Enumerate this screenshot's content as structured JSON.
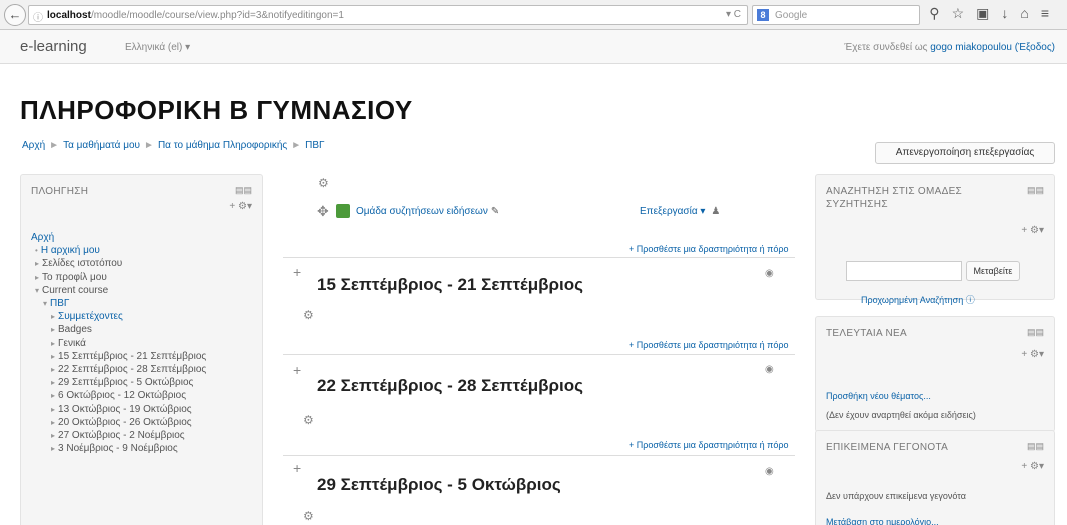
{
  "browser": {
    "url_host": "localhost",
    "url_rest": "/moodle/moodle/course/view.php?id=3&notifyeditingon=1",
    "search_placeholder": "Google",
    "g_label": "8"
  },
  "moodle_nav": {
    "brand": "e-learning",
    "language": "Ελληνικά (el) ▾",
    "login_prefix": "Έχετε συνδεθεί ως",
    "user_name": "gogo miakopoulou",
    "logout": "(Έξοδος)"
  },
  "page_title": "ΠΛΗΡΟΦΟΡΙΚΗ Β ΓΥΜΝΑΣΙΟΥ",
  "breadcrumb": [
    "Αρχή",
    "Τα μαθήματά μου",
    "Πα το μάθημα Πληροφορικής",
    "ΠΒΓ"
  ],
  "edit_button": "Απενεργοποίηση επεξεργασίας",
  "navigation_block": {
    "title": "ΠΛΟΗΓΗΣΗ",
    "items": [
      {
        "label": "Αρχή",
        "type": "link",
        "indent": 0,
        "arrow": ""
      },
      {
        "label": "Η αρχική μου",
        "type": "link",
        "indent": 1,
        "arrow": "•"
      },
      {
        "label": "Σελίδες ιστοτόπου",
        "type": "plain",
        "indent": 1,
        "arrow": "▸"
      },
      {
        "label": "Το προφίλ μου",
        "type": "plain",
        "indent": 1,
        "arrow": "▸"
      },
      {
        "label": "Current course",
        "type": "plain",
        "indent": 1,
        "arrow": "▾"
      },
      {
        "label": "ΠΒΓ",
        "type": "link",
        "indent": 2,
        "arrow": "▾"
      },
      {
        "label": "Συμμετέχοντες",
        "type": "link",
        "indent": 3,
        "arrow": "▸"
      },
      {
        "label": "Badges",
        "type": "plain",
        "indent": 3,
        "arrow": "▸"
      },
      {
        "label": "Γενικά",
        "type": "plain",
        "indent": 3,
        "arrow": "▸"
      },
      {
        "label": "15 Σεπτέμβριος - 21 Σεπτέμβριος",
        "type": "plain",
        "indent": 3,
        "arrow": "▸"
      },
      {
        "label": "22 Σεπτέμβριος - 28 Σεπτέμβριος",
        "type": "plain",
        "indent": 3,
        "arrow": "▸"
      },
      {
        "label": "29 Σεπτέμβριος - 5 Οκτώβριος",
        "type": "plain",
        "indent": 3,
        "arrow": "▸"
      },
      {
        "label": "6 Οκτώβριος - 12 Οκτώβριος",
        "type": "plain",
        "indent": 3,
        "arrow": "▸"
      },
      {
        "label": "13 Οκτώβριος - 19 Οκτώβριος",
        "type": "plain",
        "indent": 3,
        "arrow": "▸"
      },
      {
        "label": "20 Οκτώβριος - 26 Οκτώβριος",
        "type": "plain",
        "indent": 3,
        "arrow": "▸"
      },
      {
        "label": "27 Οκτώβριος - 2 Νοέμβριος",
        "type": "plain",
        "indent": 3,
        "arrow": "▸"
      },
      {
        "label": "3 Νοέμβριος - 9 Νοέμβριος",
        "type": "plain",
        "indent": 3,
        "arrow": "▸"
      }
    ]
  },
  "center": {
    "forum_link": "Ομάδα συζητήσεων ειδήσεων",
    "edit_menu": "Επεξεργασία ▾",
    "add_activity": "+ Προσθέστε μια δραστηριότητα ή πόρο",
    "sections": [
      "15 Σεπτέμβριος - 21 Σεπτέμβριος",
      "22 Σεπτέμβριος - 28 Σεπτέμβριος",
      "29 Σεπτέμβριος - 5 Οκτώβριος"
    ]
  },
  "search_block": {
    "title_line1": "ΑΝΑΖΗΤΗΣΗ ΣΤΙΣ ΟΜΑΔΕΣ",
    "title_line2": "ΣΥΖΗΤΗΣΗΣ",
    "button": "Μεταβείτε",
    "advanced": "Προχωρημένη Αναζήτηση ⓘ"
  },
  "news_block": {
    "title": "ΤΕΛΕΥΤΑΙΑ ΝΕΑ",
    "add_topic": "Προσθήκη νέου θέματος...",
    "empty": "(Δεν έχουν αναρτηθεί ακόμα ειδήσεις)"
  },
  "events_block": {
    "title": "ΕΠΙΚΕΙΜΕΝΑ ΓΕΓΟΝΟΤΑ",
    "empty": "Δεν υπάρχουν επικείμενα γεγονότα",
    "calendar_link": "Μετάβαση στο ημερολόγιο..."
  }
}
